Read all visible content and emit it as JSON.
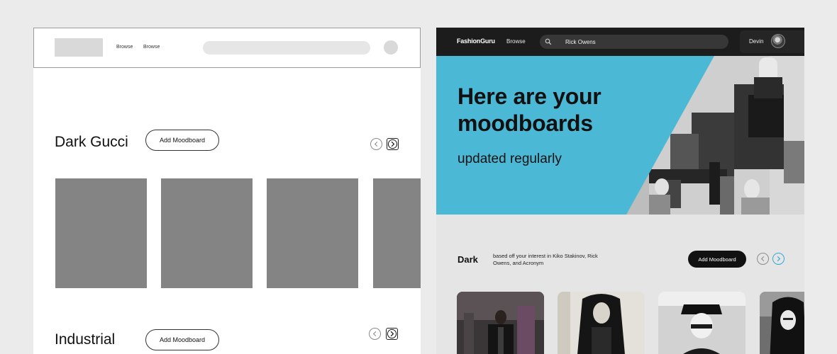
{
  "wireframe": {
    "nav": {
      "links": [
        "Browse",
        "Browse"
      ]
    },
    "sections": [
      {
        "title": "Dark Gucci",
        "button_label": "Add Moodboard"
      },
      {
        "title": "Industrial",
        "button_label": "Add Moodboard"
      }
    ]
  },
  "hifi": {
    "nav": {
      "brand": "FashionGuru",
      "browse": "Browse",
      "search_value": "Rick Owens",
      "user_name": "Devin"
    },
    "hero": {
      "title_line1": "Here are your",
      "title_line2": "moodboards",
      "subtitle": "updated regularly"
    },
    "section": {
      "title": "Dark",
      "description": "based off your interest in Kiko Stakinov, Rick Owens, and Acronym",
      "button_label": "Add Moodboard"
    }
  },
  "colors": {
    "hero_accent": "#4bb9d6",
    "next_arrow": "#2fa9d4",
    "nav_dark": "#1c1c1c"
  },
  "icons": [
    "search-icon",
    "chevron-left-icon",
    "chevron-right-icon",
    "avatar"
  ]
}
